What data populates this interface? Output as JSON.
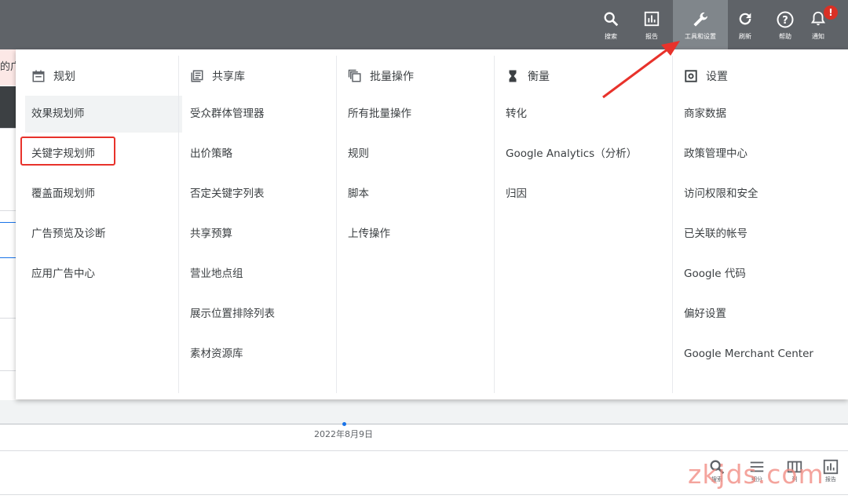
{
  "toolbar": {
    "search": {
      "label": "搜索",
      "icon": "search-icon"
    },
    "reports": {
      "label": "报告",
      "icon": "reports-icon"
    },
    "tools": {
      "label": "工具和设置",
      "icon": "wrench-icon"
    },
    "refresh": {
      "label": "刷新",
      "icon": "refresh-icon"
    },
    "help": {
      "label": "帮助",
      "icon": "help-icon"
    },
    "notifications": {
      "label": "通知",
      "icon": "bell-icon",
      "badge": "!"
    }
  },
  "background": {
    "warning_fragment": "的广",
    "date_label": "2022年8月9日"
  },
  "menu": {
    "planning": {
      "title": "规划",
      "items": [
        "效果规划师",
        "关键字规划师",
        "覆盖面规划师",
        "广告预览及诊断",
        "应用广告中心"
      ]
    },
    "shared_library": {
      "title": "共享库",
      "items": [
        "受众群体管理器",
        "出价策略",
        "否定关键字列表",
        "共享预算",
        "营业地点组",
        "展示位置排除列表",
        "素材资源库"
      ]
    },
    "bulk_actions": {
      "title": "批量操作",
      "items": [
        "所有批量操作",
        "规则",
        "脚本",
        "上传操作"
      ]
    },
    "measurement": {
      "title": "衡量",
      "items": [
        "转化",
        "Google Analytics（分析）",
        "归因"
      ]
    },
    "setup": {
      "title": "设置",
      "items": [
        "商家数据",
        "政策管理中心",
        "访问权限和安全",
        "已关联的帐号",
        "Google 代码",
        "偏好设置",
        "Google Merchant Center"
      ]
    }
  },
  "bottom_toolbar": {
    "search": "搜索",
    "segments": "细分",
    "columns": "列",
    "reports": "报告"
  },
  "watermark": "zkjds.com",
  "colors": {
    "topbar": "#5f6368",
    "active_tool": "#80868b",
    "highlight_box": "#e8322b",
    "badge": "#d93025"
  }
}
